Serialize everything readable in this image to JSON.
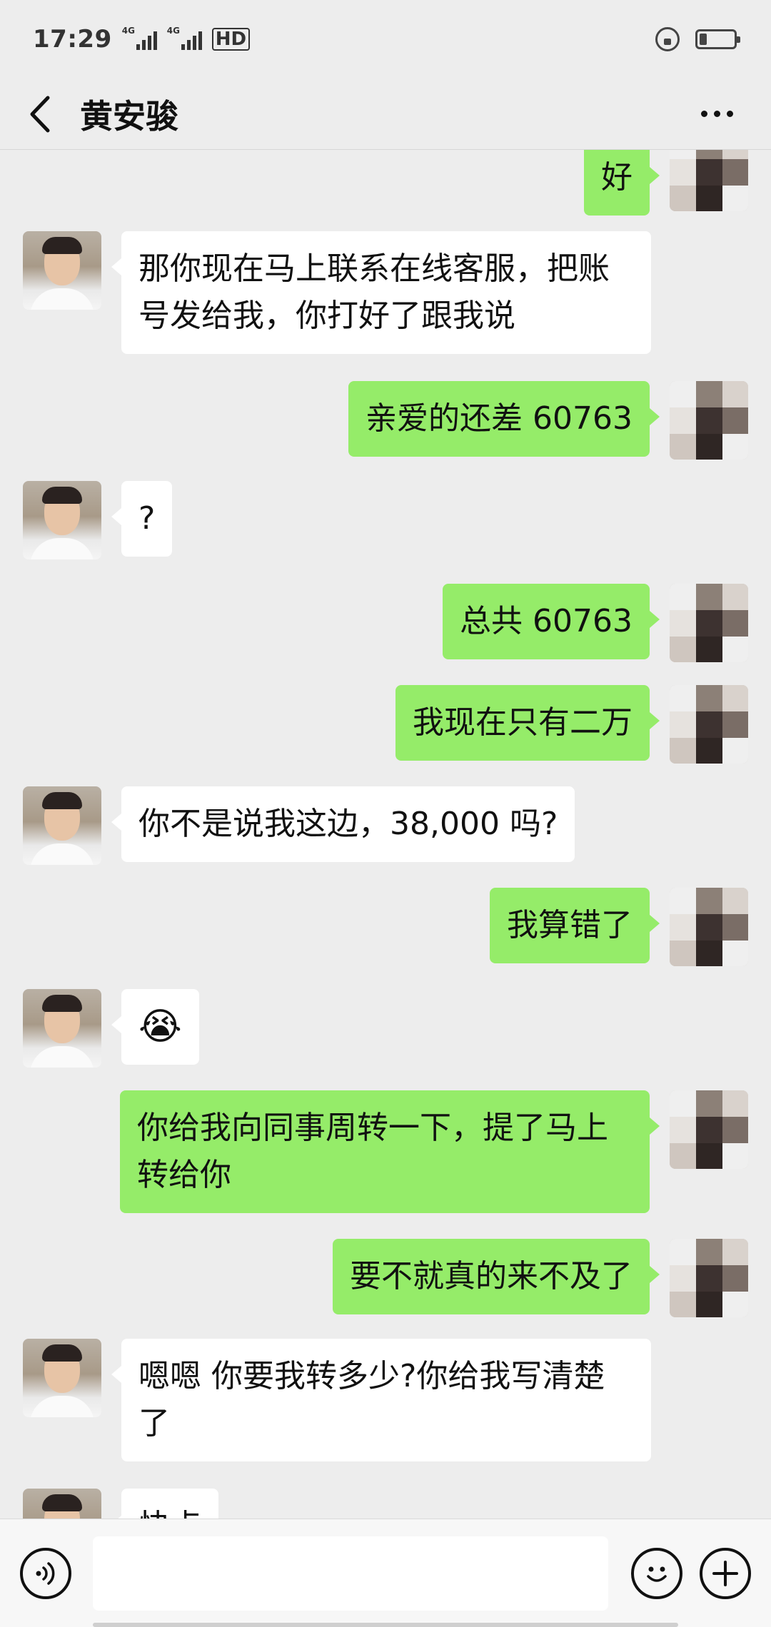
{
  "status_bar": {
    "time": "17:29",
    "network_1": "4G",
    "network_2": "4G",
    "hd_label": "HD"
  },
  "header": {
    "back_icon": "chevron-left-icon",
    "title": "黄安骏",
    "more_icon": "more-dots-icon"
  },
  "messages": [
    {
      "sender": "me",
      "text": "好"
    },
    {
      "sender": "contact",
      "text": "那你现在马上联系在线客服，把账号发给我，你打好了跟我说"
    },
    {
      "sender": "me",
      "text": "亲爱的还差 60763"
    },
    {
      "sender": "contact",
      "text": "?"
    },
    {
      "sender": "me",
      "text": "总共 60763"
    },
    {
      "sender": "me",
      "text": "我现在只有二万"
    },
    {
      "sender": "contact",
      "text": "你不是说我这边，38,000 吗?"
    },
    {
      "sender": "me",
      "text": "我算错了"
    },
    {
      "sender": "contact",
      "text": "😭"
    },
    {
      "sender": "me",
      "text": "你给我向同事周转一下，提了马上转给你"
    },
    {
      "sender": "me",
      "text": "要不就真的来不及了"
    },
    {
      "sender": "contact",
      "text": "嗯嗯 你要我转多少?你给我写清楚了"
    },
    {
      "sender": "contact",
      "text": "快点"
    }
  ],
  "input_bar": {
    "voice_icon": "voice-icon",
    "input_value": "",
    "emoji_icon": "emoji-icon",
    "plus_icon": "plus-icon"
  },
  "colors": {
    "background": "#ededed",
    "outgoing_bubble": "#95ec69",
    "incoming_bubble": "#ffffff"
  }
}
